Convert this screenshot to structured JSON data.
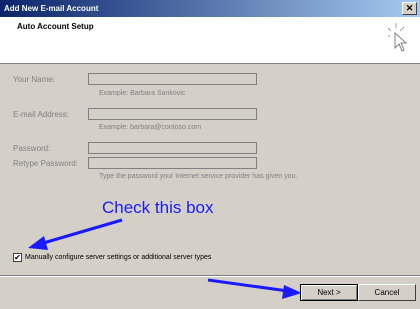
{
  "window": {
    "title": "Add New E-mail Account",
    "close_glyph": "✕"
  },
  "header": {
    "title": "Auto Account Setup",
    "icon": "cursor-click-icon"
  },
  "form": {
    "name_label": "Your Name:",
    "name_value": "",
    "name_hint": "Example: Barbara Sankovic",
    "email_label": "E-mail Address:",
    "email_value": "",
    "email_hint": "Example: barbara@contoso.com",
    "password_label": "Password:",
    "password_value": "",
    "retype_label": "Retype Password:",
    "retype_value": "",
    "password_hint": "Type the password your Internet service provider has given you."
  },
  "annotation": {
    "text": "Check this box",
    "color": "#1a1aff"
  },
  "manual_config": {
    "checked": true,
    "check_glyph": "✔",
    "label": "Manually configure server settings or additional server types"
  },
  "buttons": {
    "back": "",
    "next": "Next >",
    "cancel": "Cancel"
  }
}
